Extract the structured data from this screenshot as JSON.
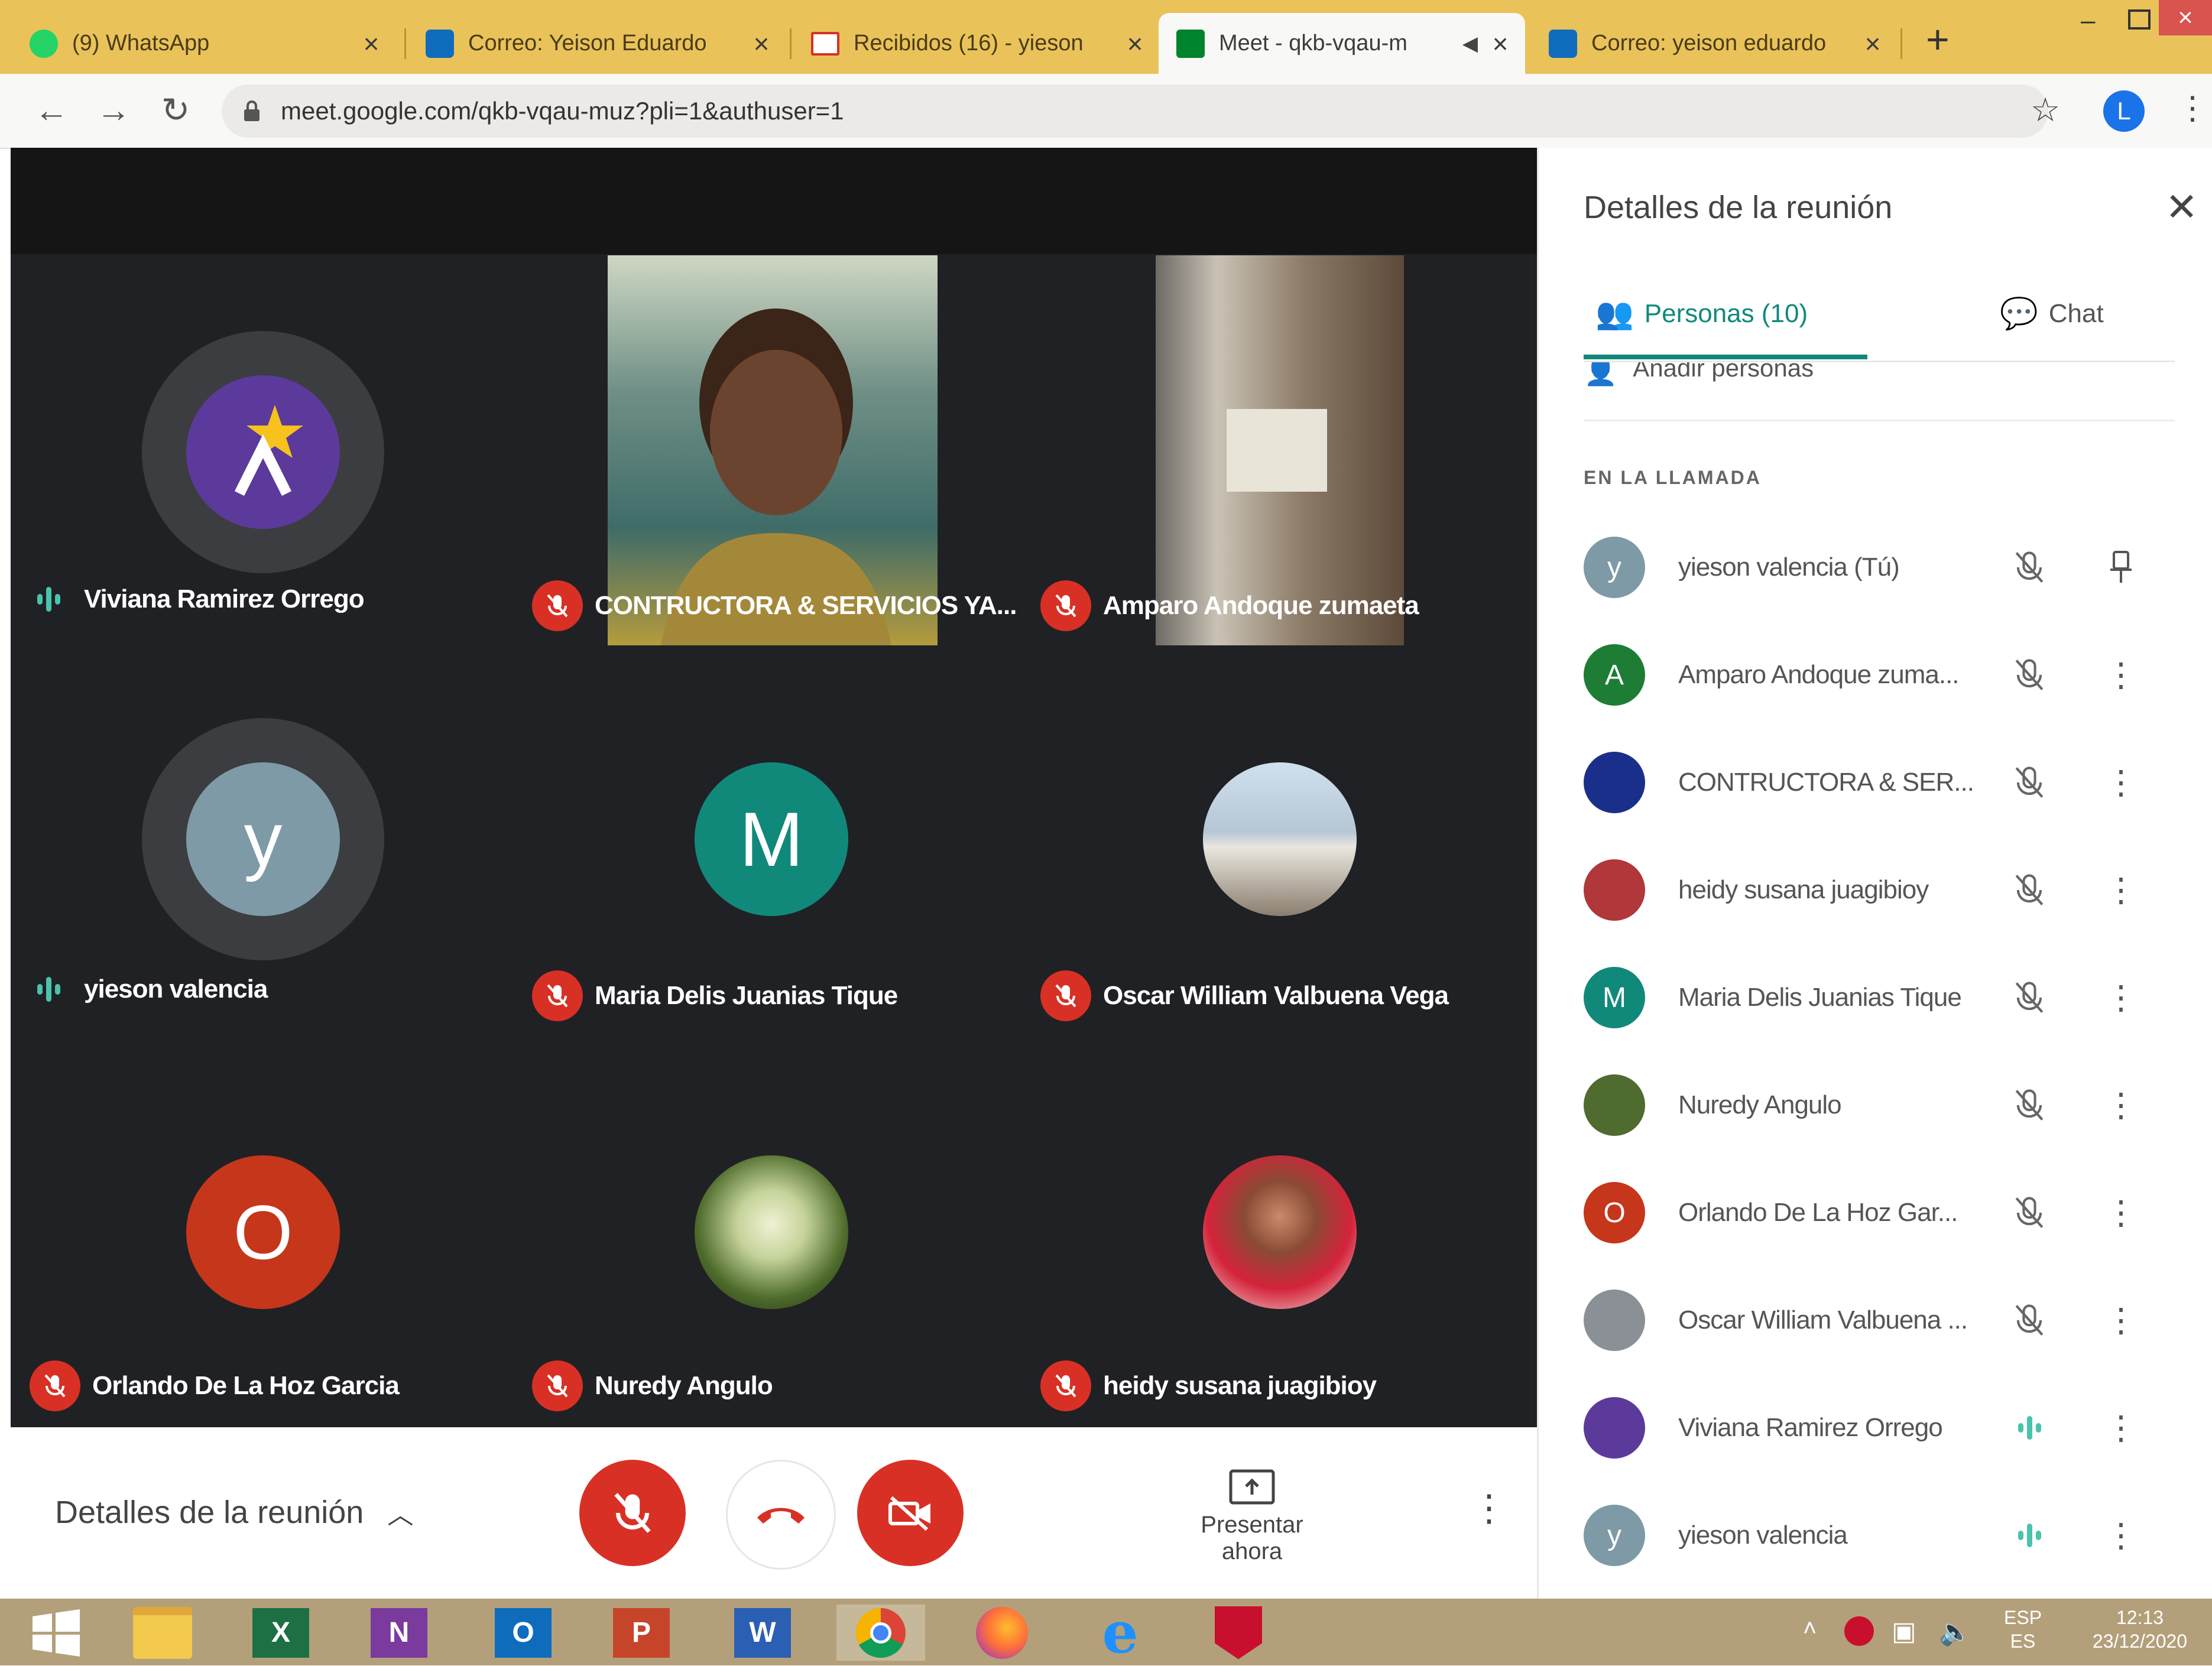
{
  "browser": {
    "tabs": [
      {
        "title": "(9) WhatsApp",
        "icon": "whatsapp-icon",
        "color": "#25d366"
      },
      {
        "title": "Correo: Yeison Eduardo",
        "icon": "outlook-icon",
        "color": "#0f6cbd"
      },
      {
        "title": "Recibidos (16) - yieson",
        "icon": "gmail-icon",
        "color": "#d93025"
      },
      {
        "title": "Meet - qkb-vqau-m",
        "icon": "meet-icon",
        "color": "#00832d"
      },
      {
        "title": "Correo: yeison eduardo",
        "icon": "outlook-icon",
        "color": "#0f6cbd"
      }
    ],
    "new_tab": "+",
    "url": "meet.google.com/qkb-vqau-muz?pli=1&authuser=1",
    "profile_initial": "L"
  },
  "meet": {
    "tiles": [
      {
        "name": "Viviana Ramirez Orrego",
        "mic": "speaking",
        "kind": "logo"
      },
      {
        "name": "CONTRUCTORA & SERVICIOS YA...",
        "mic": "muted",
        "kind": "video-person"
      },
      {
        "name": "Amparo Andoque zumaeta",
        "mic": "muted",
        "kind": "video-room"
      },
      {
        "name": "yieson valencia",
        "mic": "speaking",
        "kind": "initial",
        "initial": "y",
        "color": "#7d9aa6"
      },
      {
        "name": "Maria Delis Juanias Tique",
        "mic": "muted",
        "kind": "initial",
        "initial": "M",
        "color": "#11897a"
      },
      {
        "name": "Oscar William Valbuena Vega",
        "mic": "muted",
        "kind": "photo-landscape"
      },
      {
        "name": "Orlando De La Hoz Garcia",
        "mic": "muted",
        "kind": "initial",
        "initial": "O",
        "color": "#c5361b"
      },
      {
        "name": "Nuredy Angulo",
        "mic": "muted",
        "kind": "photo-flower"
      },
      {
        "name": "heidy susana juagibioy",
        "mic": "muted",
        "kind": "photo-woman"
      }
    ],
    "bottom": {
      "details_label": "Detalles de la reunión",
      "present_label": "Presentar ahora"
    }
  },
  "panel": {
    "title": "Detalles de la reunión",
    "tab_people": "Personas (10)",
    "tab_chat": "Chat",
    "add_people": "Añadir personas",
    "section_label": "EN LA LLAMADA",
    "people": [
      {
        "name": "yieson valencia (Tú)",
        "avatar": "initial",
        "initial": "y",
        "color": "#7d9aa6",
        "mic": "muted",
        "action": "pin"
      },
      {
        "name": "Amparo Andoque zuma...",
        "avatar": "initial",
        "initial": "A",
        "color": "#1e7d34",
        "mic": "muted",
        "action": "more"
      },
      {
        "name": "CONTRUCTORA & SER...",
        "avatar": "photo",
        "color": "#1a2f8a",
        "mic": "muted",
        "action": "more"
      },
      {
        "name": "heidy susana juagibioy",
        "avatar": "photo",
        "color": "#b0373a",
        "mic": "muted",
        "action": "more"
      },
      {
        "name": "Maria Delis Juanias Tique",
        "avatar": "initial",
        "initial": "M",
        "color": "#11897a",
        "mic": "muted",
        "action": "more"
      },
      {
        "name": "Nuredy Angulo",
        "avatar": "photo",
        "color": "#4f6b2f",
        "mic": "muted",
        "action": "more"
      },
      {
        "name": "Orlando De La Hoz Gar...",
        "avatar": "initial",
        "initial": "O",
        "color": "#c5361b",
        "mic": "muted",
        "action": "more"
      },
      {
        "name": "Oscar William Valbuena ...",
        "avatar": "photo",
        "color": "#8b8f96",
        "mic": "muted",
        "action": "more"
      },
      {
        "name": "Viviana Ramirez Orrego",
        "avatar": "logo",
        "color": "#5b3a9b",
        "mic": "speaking",
        "action": "more"
      },
      {
        "name": "yieson valencia",
        "avatar": "initial",
        "initial": "y",
        "color": "#7d9aa6",
        "mic": "speaking",
        "action": "more"
      }
    ]
  },
  "taskbar": {
    "apps": [
      "windows-start-icon",
      "file-explorer-icon",
      "excel-icon",
      "onenote-icon",
      "outlook-icon",
      "powerpoint-icon",
      "word-icon",
      "chrome-icon",
      "firefox-icon",
      "internet-explorer-icon",
      "mcafee-icon"
    ],
    "lang_top": "ESP",
    "lang_bottom": "ES",
    "time": "12:13",
    "date": "23/12/2020"
  }
}
